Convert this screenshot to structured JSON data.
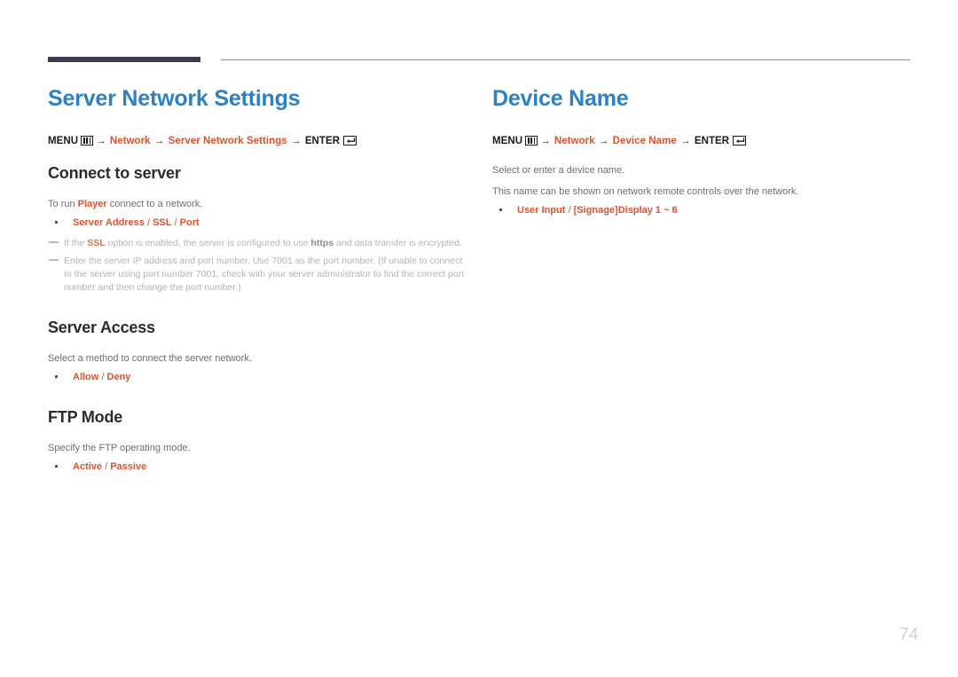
{
  "document": {
    "page_number": "74",
    "accent_color": "#e0512a",
    "title_color": "#2e80c2",
    "rule_color": "#403a4c"
  },
  "left_column": {
    "title": "Server Network Settings",
    "menu_path": {
      "menu_label": "MENU",
      "menu_icon": "menu-grid-icon",
      "arrow1": "→",
      "item1": "Network",
      "arrow2": "→",
      "item2": "Server Network Settings",
      "arrow3": "→",
      "enter_label": "ENTER",
      "enter_icon": "enter-return-icon"
    },
    "section1": {
      "heading": "Connect to server",
      "description_pre": "To run ",
      "description_bold": "Player",
      "description_post": " connect to a network.",
      "bullets": [
        {
          "parts": [
            "Server Address",
            " / ",
            "SSL",
            " / ",
            "Port"
          ]
        }
      ],
      "notes": [
        {
          "segments": [
            {
              "text": "If the ",
              "style": "plain"
            },
            {
              "text": "SSL",
              "style": "accent"
            },
            {
              "text": " option is enabled, the server is configured to use ",
              "style": "plain"
            },
            {
              "text": "https",
              "style": "dark"
            },
            {
              "text": " and data transfer is encrypted.",
              "style": "plain"
            }
          ]
        },
        {
          "segments": [
            {
              "text": "Enter the server IP address and port number. Use 7001 as the port number. (If unable to connect to the server using port number 7001, check with your server administrator to find the correct port number and then change the port number.)",
              "style": "plain"
            }
          ]
        }
      ]
    },
    "section2": {
      "heading": "Server Access",
      "description": "Select a method to connect the server network.",
      "bullets": [
        {
          "parts": [
            "Allow",
            " / ",
            "Deny"
          ]
        }
      ]
    },
    "section3": {
      "heading": "FTP Mode",
      "description": "Specify the FTP operating mode.",
      "bullets": [
        {
          "parts": [
            "Active",
            " / ",
            "Passive"
          ]
        }
      ]
    }
  },
  "right_column": {
    "title": "Device Name",
    "menu_path": {
      "menu_label": "MENU",
      "menu_icon": "menu-grid-icon",
      "arrow1": "→",
      "item1": "Network",
      "arrow2": "→",
      "item2": "Device Name",
      "arrow3": "→",
      "enter_label": "ENTER",
      "enter_icon": "enter-return-icon"
    },
    "description1": "Select or enter a device name.",
    "description2": "This name can be shown on network remote controls over the network.",
    "bullets": [
      {
        "parts": [
          "User Input",
          " / ",
          "[Signage]Display 1 ~ 6"
        ]
      }
    ]
  }
}
